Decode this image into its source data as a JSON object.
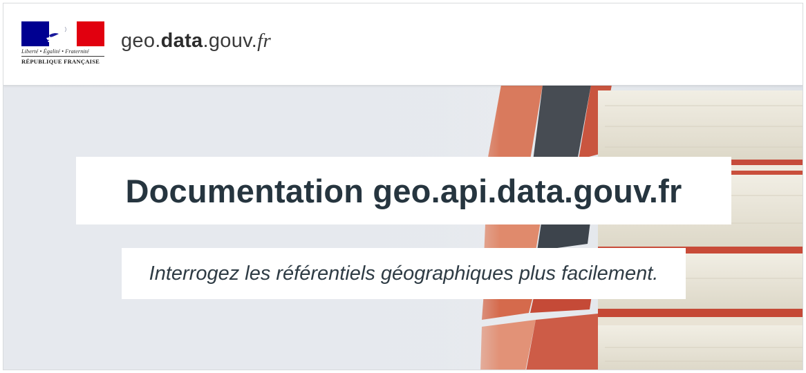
{
  "header": {
    "logo": {
      "motto": "Liberté • Égalité • Fraternité",
      "republic": "RÉPUBLIQUE FRANÇAISE",
      "flag_colors": [
        "#000091",
        "#ffffff",
        "#e1000f"
      ],
      "icon": "marianne-logo"
    },
    "site_name": {
      "prefix": "geo.",
      "bold": "data",
      "middle": ".gouv.",
      "tld": "fr"
    }
  },
  "hero": {
    "title": "Documentation geo.api.data.gouv.fr",
    "subtitle": "Interrogez les référentiels géographiques plus facilement.",
    "background_image": "stack-of-books"
  },
  "colors": {
    "title_text": "#26353f",
    "hero_background": "#e6e9ee"
  }
}
